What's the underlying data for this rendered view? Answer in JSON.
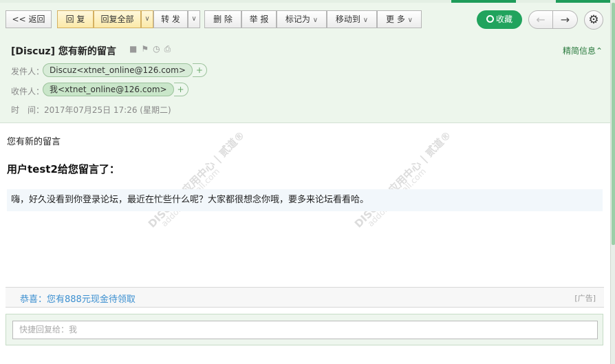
{
  "toolbar": {
    "back_label": "<< 返回",
    "reply_label": "回 复",
    "reply_all_label": "回复全部",
    "forward_label": "转 发",
    "delete_label": "删 除",
    "report_label": "举 报",
    "mark_as_label": "标记为",
    "move_to_label": "移动到",
    "more_label": "更 多",
    "favorite_label": "收藏",
    "caret": "∨",
    "prev_arrow": "←",
    "next_arrow": "→",
    "gear": "⚙"
  },
  "header": {
    "subject": "[Discuz] 您有新的留言",
    "detail_link": "精简信息",
    "from_label": "发件人：",
    "from_value": "Discuz<xtnet_online@126.com>",
    "to_label": "收件人：",
    "to_value": "我<xtnet_online@126.com>",
    "add_plus": "+",
    "time_label": "时　间：",
    "time_value": "2017年07月25日 17:26 (星期二)"
  },
  "body": {
    "line1": "您有新的留言",
    "heading": "用户test2给您留言了：",
    "quote": "嗨，好久没看到你登录论坛，最近在忙些什么呢？大家都很想念你哦，要多来论坛看看哈。"
  },
  "watermark": {
    "text": "DISCUZ!应用中心 | 贰道®",
    "url": "addon.dismall.com"
  },
  "ad": {
    "text": "恭喜：您有888元现金待领取",
    "tag": "[广告]"
  },
  "reply": {
    "placeholder": "快捷回复给：我"
  },
  "colors": {
    "accent_green": "#21a35d",
    "header_bg": "#edf6ec",
    "link_blue": "#3b8fd0"
  }
}
